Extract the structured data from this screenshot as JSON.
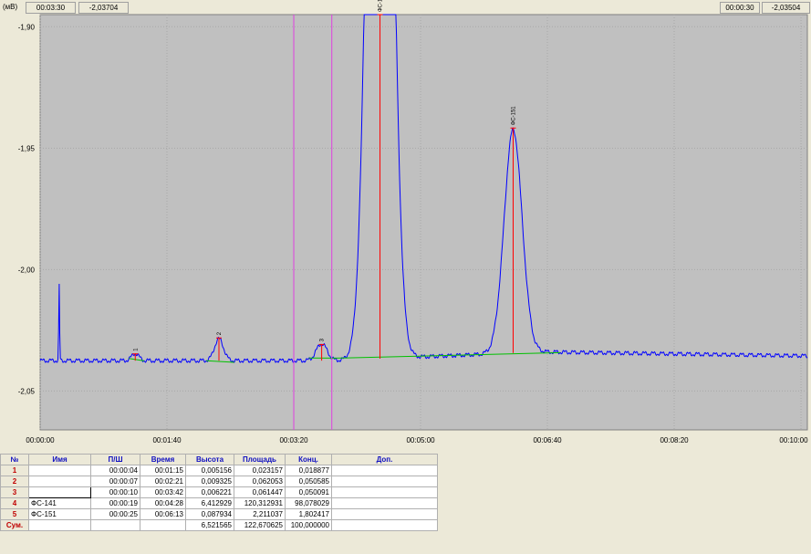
{
  "readouts": {
    "left_time": "00:03:30",
    "left_value": "-2,03704",
    "right_time": "00:00:30",
    "right_value": "-2,03504"
  },
  "chart_data": {
    "type": "line",
    "ylabel": "(мВ)",
    "xlim": [
      0,
      605
    ],
    "ylim": [
      -2.066,
      -1.895
    ],
    "y_ticks": [
      {
        "value": -1.9,
        "label": "-1,90"
      },
      {
        "value": -1.95,
        "label": "-1,95"
      },
      {
        "value": -2.0,
        "label": "-2,00"
      },
      {
        "value": -2.05,
        "label": "-2,05"
      }
    ],
    "x_ticks": [
      {
        "value": 0,
        "label": "00:00:00"
      },
      {
        "value": 100,
        "label": "00:01:40"
      },
      {
        "value": 200,
        "label": "00:03:20"
      },
      {
        "value": 300,
        "label": "00:05:00"
      },
      {
        "value": 400,
        "label": "00:06:40"
      },
      {
        "value": 500,
        "label": "00:08:20"
      },
      {
        "value": 600,
        "label": "00:10:00"
      }
    ],
    "grid": true,
    "signal_color": "#0000ff",
    "baseline_color": "#00c000",
    "peak_marker_color": "#ff0000",
    "cursor_color": "#e040e0",
    "baseline_level": -2.0375,
    "spike": {
      "x": 15,
      "y": -2.0065
    },
    "peaks": [
      {
        "label": "1",
        "time": 75,
        "apex": -2.0345,
        "width": 4
      },
      {
        "label": "2",
        "time": 141,
        "apex": -2.0285,
        "width": 5
      },
      {
        "label": "3",
        "time": 222,
        "apex": -2.0305,
        "width": 6
      },
      {
        "label": "ФС-141",
        "time": 268,
        "apex": -1.5,
        "width": 11
      },
      {
        "label": "ФС-151",
        "time": 373,
        "apex": -1.9455,
        "width": 10
      }
    ],
    "cursors": [
      200,
      230
    ],
    "clip_top": -1.895
  },
  "table": {
    "headers": [
      "№",
      "Имя",
      "П/Ш",
      "Время",
      "Высота",
      "Площадь",
      "Конц.",
      "Доп."
    ],
    "rows": [
      {
        "num": "1",
        "name": "",
        "pw": "00:00:04",
        "time": "00:01:15",
        "height": "0,005156",
        "area": "0,023157",
        "conc": "0,018877",
        "extra": ""
      },
      {
        "num": "2",
        "name": "",
        "pw": "00:00:07",
        "time": "00:02:21",
        "height": "0,009325",
        "area": "0,062053",
        "conc": "0,050585",
        "extra": ""
      },
      {
        "num": "3",
        "name": "",
        "pw": "00:00:10",
        "time": "00:03:42",
        "height": "0,006221",
        "area": "0,061447",
        "conc": "0,050091",
        "extra": ""
      },
      {
        "num": "4",
        "name": "ФС-141",
        "pw": "00:00:19",
        "time": "00:04:28",
        "height": "6,412929",
        "area": "120,312931",
        "conc": "98,078029",
        "extra": ""
      },
      {
        "num": "5",
        "name": "ФС-151",
        "pw": "00:00:25",
        "time": "00:06:13",
        "height": "0,087934",
        "area": "2,211037",
        "conc": "1,802417",
        "extra": ""
      }
    ],
    "sum": {
      "num": "Сум.",
      "height": "6,521565",
      "area": "122,670625",
      "conc": "100,000000"
    }
  }
}
